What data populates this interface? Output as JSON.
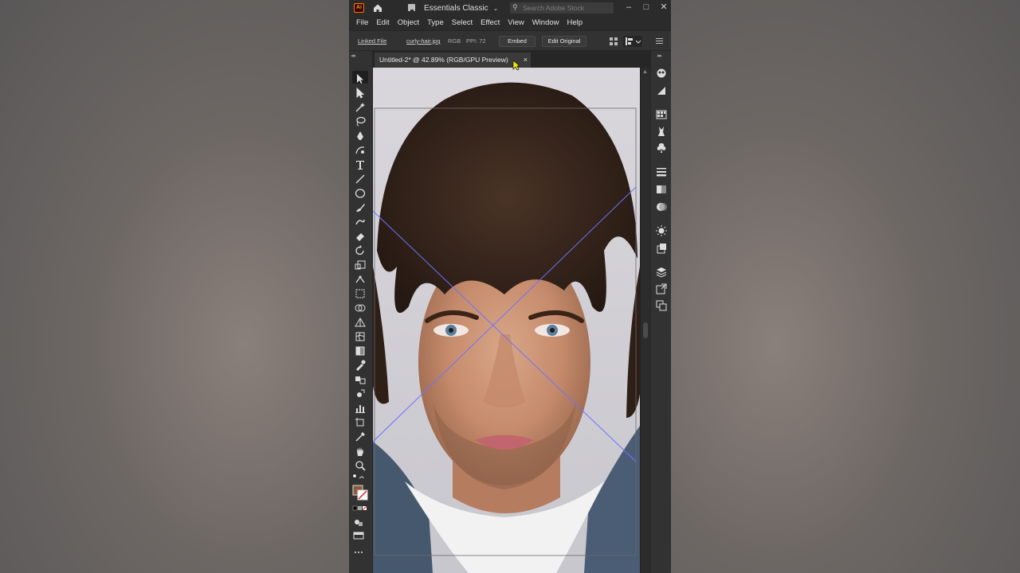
{
  "app": {
    "logo_text": "Ai",
    "workspace": "Essentials Classic",
    "search_placeholder": "Search Adobe Stock"
  },
  "menu": [
    "File",
    "Edit",
    "Object",
    "Type",
    "Select",
    "Effect",
    "View",
    "Window",
    "Help"
  ],
  "control_bar": {
    "linked_file_label": "Linked File",
    "file_name": "curly-hair.jpg",
    "color_mode": "RGB",
    "ppi": "PPI: 72",
    "embed_button": "Embed",
    "edit_original_button": "Edit Original"
  },
  "document": {
    "tab_title": "Untitled-2* @ 42.89% (RGB/GPU Preview)",
    "close_glyph": "×"
  },
  "colors": {
    "ui_dark": "#323232",
    "ui_darker": "#2b2b2b",
    "selection_blue": "#6c73ff",
    "fill_swatch": "#8b5a3c"
  },
  "icons": {
    "left_toolbar": [
      "selection-tool-icon",
      "direct-selection-tool-icon",
      "magic-wand-tool-icon",
      "lasso-tool-icon",
      "pen-tool-icon",
      "curvature-tool-icon",
      "type-tool-icon",
      "line-segment-tool-icon",
      "ellipse-tool-icon",
      "paintbrush-tool-icon",
      "shaper-tool-icon",
      "eraser-tool-icon",
      "rotate-tool-icon",
      "scale-tool-icon",
      "width-tool-icon",
      "free-transform-tool-icon",
      "shape-builder-tool-icon",
      "perspective-grid-tool-icon",
      "mesh-tool-icon",
      "gradient-tool-icon",
      "eyedropper-tool-icon",
      "blend-tool-icon",
      "symbol-sprayer-tool-icon",
      "column-graph-tool-icon",
      "artboard-tool-icon",
      "slice-tool-icon",
      "hand-tool-icon",
      "zoom-tool-icon"
    ],
    "right_panel": [
      "color-panel-icon",
      "color-guide-icon",
      "swatches-icon",
      "brushes-icon",
      "symbols-icon",
      "stroke-icon",
      "gradient-panel-icon",
      "transparency-icon",
      "appearance-icon",
      "graphic-styles-icon",
      "layers-icon",
      "asset-export-icon",
      "artboards-panel-icon"
    ]
  }
}
